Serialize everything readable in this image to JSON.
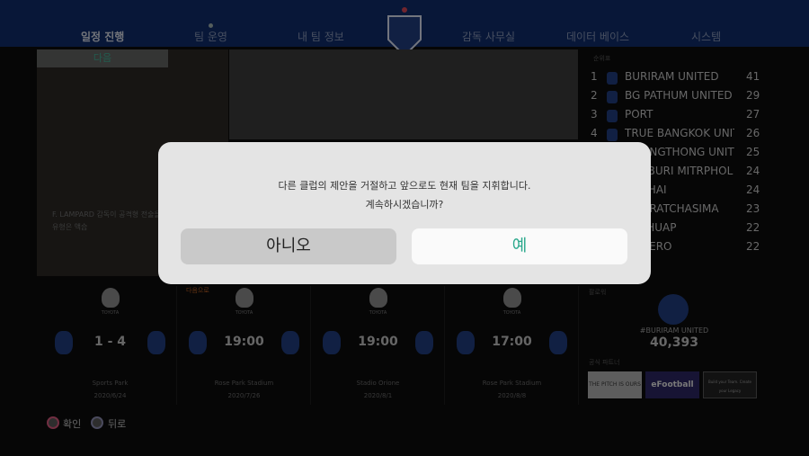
{
  "nav": {
    "items": [
      "일정 진행",
      "팀 운영",
      "내 팀 정보",
      "감독 사무실",
      "데이터 베이스",
      "시스템"
    ],
    "active": 0
  },
  "news": {
    "badge": "다음",
    "caption1": "F. LAMPARD 감독이 공격형 전술을",
    "caption2": "유형은 액습"
  },
  "standings": {
    "title": "순위표",
    "rows": [
      {
        "rank": "1",
        "team": "BURIRAM UNITED",
        "pts": "41"
      },
      {
        "rank": "2",
        "team": "BG PATHUM UNITED",
        "pts": "29"
      },
      {
        "rank": "3",
        "team": "PORT",
        "pts": "27"
      },
      {
        "rank": "4",
        "team": "TRUE BANGKOK UNITED",
        "pts": "26"
      },
      {
        "rank": "",
        "team": "MUANGTHONG UNITED",
        "pts": "25"
      },
      {
        "rank": "",
        "team": "CHABURI MITRPHOL",
        "pts": "24"
      },
      {
        "rank": "",
        "team": "HOTHAI",
        "pts": "24"
      },
      {
        "rank": "",
        "team": "HONRATCHASIMA",
        "pts": "23"
      },
      {
        "rank": "",
        "team": "RACHUAP",
        "pts": "22"
      },
      {
        "rank": "",
        "team": "CE TERO",
        "pts": "22"
      }
    ]
  },
  "fixtures": {
    "next_label": "다음으로",
    "league": "TOYOTA",
    "items": [
      {
        "score": "1 - 4",
        "stadium": "Sports Park",
        "date": "2020/6/24"
      },
      {
        "score": "19:00",
        "stadium": "Rose Park Stadium",
        "date": "2020/7/26"
      },
      {
        "score": "19:00",
        "stadium": "Stadio Orione",
        "date": "2020/8/1"
      },
      {
        "score": "17:00",
        "stadium": "Rose Park Stadium",
        "date": "2020/8/8"
      }
    ]
  },
  "followers": {
    "title": "팔로워",
    "tag": "#BURIRAM UNITED",
    "count": "40,393"
  },
  "partners": {
    "title": "공식 파트너",
    "items": [
      "THE PITCH IS OURS",
      "eFootball",
      "Build your Team. Create your Legacy"
    ]
  },
  "footer": {
    "confirm": "확인",
    "back": "뒤로"
  },
  "dialog": {
    "line1": "다른 클럽의 제안을 거절하고 앞으로도 현재 팀을 지휘합니다.",
    "line2": "계속하시겠습니까?",
    "no": "아니오",
    "yes": "예"
  }
}
